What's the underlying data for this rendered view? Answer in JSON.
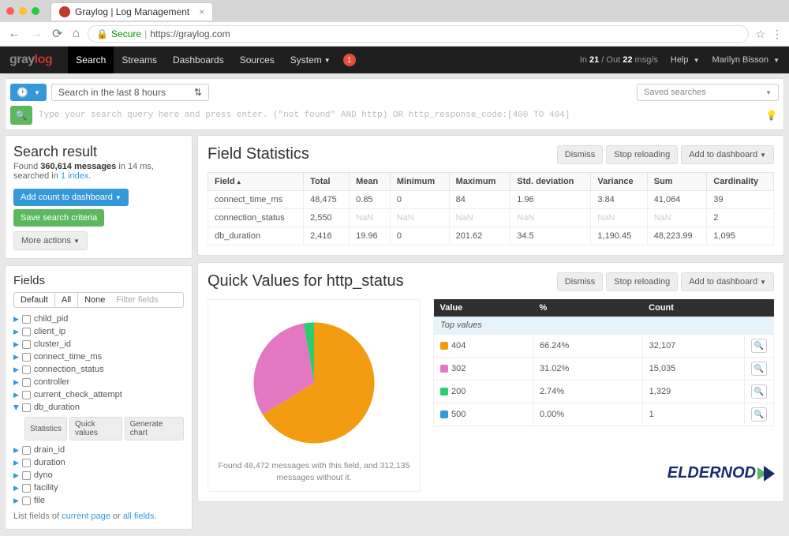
{
  "browser": {
    "tab_title": "Graylog | Log Management",
    "secure_label": "Secure",
    "url": "https://graylog.com"
  },
  "header": {
    "logo_gray": "gray",
    "logo_log": "log",
    "nav": [
      "Search",
      "Streams",
      "Dashboards",
      "Sources",
      "System"
    ],
    "notif_count": "1",
    "throughput": "In 21 / Out 22 msg/s",
    "help": "Help",
    "user": "Marilyn Bisson"
  },
  "toolbar": {
    "time_range": "Search in the last 8 hours",
    "saved_searches": "Saved searches",
    "search_placeholder": "Type your search query here and press enter. (\"not found\" AND http) OR http_response_code:[400 TO 404]"
  },
  "sidebar": {
    "title": "Search result",
    "found_prefix": "Found ",
    "found_count": "360,614 messages",
    "found_suffix": " in 14 ms, searched in ",
    "index_link": "1 index",
    "add_count": "Add count to dashboard",
    "save_criteria": "Save search criteria",
    "more_actions": "More actions",
    "fields_heading": "Fields",
    "pills": [
      "Default",
      "All",
      "None"
    ],
    "filter_placeholder": "Filter fields",
    "fields": [
      "child_pid",
      "client_ip",
      "cluster_id",
      "connect_time_ms",
      "connection_status",
      "controller",
      "current_check_attempt",
      "db_duration",
      "drain_id",
      "duration",
      "dyno",
      "facility",
      "file"
    ],
    "expanded_field_index": 7,
    "sub_actions": [
      "Statistics",
      "Quick values",
      "Generate chart"
    ],
    "footer_prefix": "List fields of ",
    "footer_link1": "current page",
    "footer_mid": " or ",
    "footer_link2": "all fields",
    "footer_end": "."
  },
  "actions": {
    "dismiss": "Dismiss",
    "stop_reloading": "Stop reloading",
    "add_to_dashboard": "Add to dashboard"
  },
  "field_stats": {
    "title": "Field Statistics",
    "columns": [
      "Field",
      "Total",
      "Mean",
      "Minimum",
      "Maximum",
      "Std. deviation",
      "Variance",
      "Sum",
      "Cardinality"
    ],
    "rows": [
      {
        "field": "connect_time_ms",
        "total": "48,475",
        "mean": "0.85",
        "min": "0",
        "max": "84",
        "std": "1.96",
        "var": "3.84",
        "sum": "41,064",
        "card": "39"
      },
      {
        "field": "connection_status",
        "total": "2,550",
        "mean": "NaN",
        "min": "NaN",
        "max": "NaN",
        "std": "NaN",
        "var": "NaN",
        "sum": "NaN",
        "card": "2"
      },
      {
        "field": "db_duration",
        "total": "2,416",
        "mean": "19.96",
        "min": "0",
        "max": "201.62",
        "std": "34.5",
        "var": "1,190.45",
        "sum": "48,223.99",
        "card": "1,095"
      }
    ]
  },
  "quick_values": {
    "title": "Quick Values for http_status",
    "table_headers": [
      "Value",
      "%",
      "Count"
    ],
    "top_values_label": "Top values",
    "rows": [
      {
        "value": "404",
        "pct": "66.24%",
        "count": "32,107",
        "color": "#f39c12"
      },
      {
        "value": "302",
        "pct": "31.02%",
        "count": "15,035",
        "color": "#e377c2"
      },
      {
        "value": "200",
        "pct": "2.74%",
        "count": "1,329",
        "color": "#2ecc71"
      },
      {
        "value": "500",
        "pct": "0.00%",
        "count": "1",
        "color": "#3498db"
      }
    ],
    "caption": "Found 48,472 messages with this field, and 312,135 messages without it."
  },
  "chart_data": {
    "type": "pie",
    "title": "Quick Values for http_status",
    "series": [
      {
        "name": "404",
        "value": 66.24,
        "color": "#f39c12"
      },
      {
        "name": "302",
        "value": 31.02,
        "color": "#e377c2"
      },
      {
        "name": "200",
        "value": 2.74,
        "color": "#2ecc71"
      },
      {
        "name": "500",
        "value": 0.0,
        "color": "#3498db"
      }
    ]
  },
  "watermark": "ELDERNODE"
}
